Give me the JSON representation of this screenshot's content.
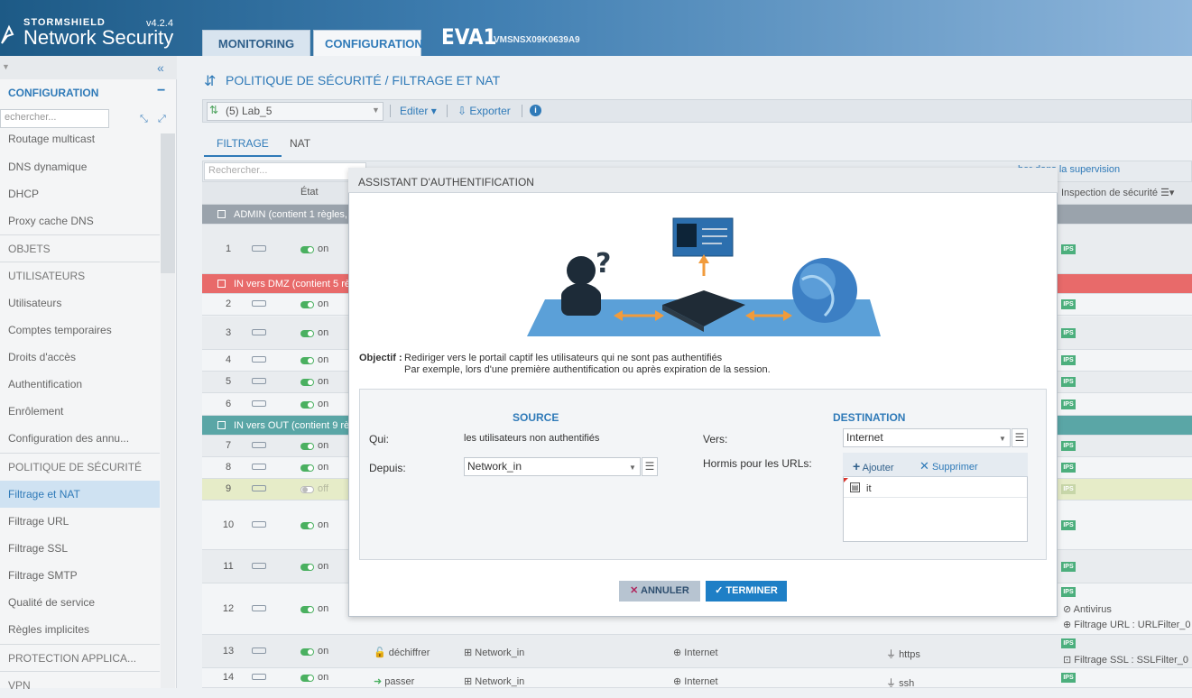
{
  "header": {
    "brand_top": "STORMSHIELD",
    "brand_main": "Network Security",
    "version": "v4.2.4",
    "tabs": [
      "MONITORING",
      "CONFIGURATION"
    ],
    "firewall_name": "EVA1",
    "firewall_serial": "VMSNSX09K0639A9"
  },
  "sidebar": {
    "section_title": "CONFIGURATION",
    "search_placeholder": "echercher...",
    "items": [
      {
        "label": "Routage multicast",
        "type": "item"
      },
      {
        "label": "DNS dynamique",
        "type": "item"
      },
      {
        "label": "DHCP",
        "type": "item"
      },
      {
        "label": "Proxy cache DNS",
        "type": "item"
      },
      {
        "label": "OBJETS",
        "type": "section"
      },
      {
        "label": "UTILISATEURS",
        "type": "section"
      },
      {
        "label": "Utilisateurs",
        "type": "item"
      },
      {
        "label": "Comptes temporaires",
        "type": "item"
      },
      {
        "label": "Droits d'accès",
        "type": "item"
      },
      {
        "label": "Authentification",
        "type": "item"
      },
      {
        "label": "Enrôlement",
        "type": "item"
      },
      {
        "label": "Configuration des annu...",
        "type": "item"
      },
      {
        "label": "POLITIQUE DE SÉCURITÉ",
        "type": "section"
      },
      {
        "label": "Filtrage et NAT",
        "type": "active"
      },
      {
        "label": "Filtrage URL",
        "type": "item"
      },
      {
        "label": "Filtrage SSL",
        "type": "item"
      },
      {
        "label": "Filtrage SMTP",
        "type": "item"
      },
      {
        "label": "Qualité de service",
        "type": "item"
      },
      {
        "label": "Règles implicites",
        "type": "item"
      },
      {
        "label": "PROTECTION APPLICA...",
        "type": "section"
      },
      {
        "label": "VPN",
        "type": "section"
      }
    ]
  },
  "main": {
    "title": "POLITIQUE DE SÉCURITÉ / FILTRAGE ET NAT",
    "policy": "(5) Lab_5",
    "editer": "Editer",
    "exporter": "Exporter",
    "subtabs": [
      "FILTRAGE",
      "NAT"
    ],
    "grid_search_placeholder": "Rechercher...",
    "supervision": "her dans la supervision",
    "col_etat": "État",
    "col_inspection": "Inspection de sécurité",
    "separators": {
      "admin": "ADMIN (contient 1 règles,",
      "dmz": "IN vers DMZ  (contient 5 rè",
      "out": "IN vers OUT (contient 9 rè"
    },
    "rows": [
      {
        "num": "1",
        "state": "on"
      },
      {
        "num": "2",
        "state": "on"
      },
      {
        "num": "3",
        "state": "on"
      },
      {
        "num": "4",
        "state": "on"
      },
      {
        "num": "5",
        "state": "on"
      },
      {
        "num": "6",
        "state": "on"
      },
      {
        "num": "7",
        "state": "on"
      },
      {
        "num": "8",
        "state": "on"
      },
      {
        "num": "9",
        "state": "off"
      },
      {
        "num": "10",
        "state": "on"
      },
      {
        "num": "11",
        "state": "on"
      },
      {
        "num": "12",
        "state": "on"
      },
      {
        "num": "13",
        "state": "on"
      },
      {
        "num": "14",
        "state": "on"
      }
    ],
    "ips_label": "IPS",
    "row12_antivirus": "Antivirus",
    "row12_url": "Filtrage URL : URLFilter_0",
    "row13_action": "déchiffrer",
    "row13_source": "Network_in",
    "row13_dest": "Internet",
    "row13_port": "https",
    "row13_ssl": "Filtrage SSL : SSLFilter_0",
    "row14_action": "passer",
    "row14_source": "Network_in",
    "row14_dest": "Internet",
    "row14_port": "ssh"
  },
  "modal": {
    "title": "ASSISTANT D'AUTHENTIFICATION",
    "objectif_label": "Objectif :",
    "objectif_line1": "Rediriger vers le portail captif les utilisateurs qui ne sont pas authentifiés",
    "objectif_line2": "Par exemple, lors d'une première authentification ou après expiration de la session.",
    "source_heading": "SOURCE",
    "destination_heading": "DESTINATION",
    "qui_label": "Qui:",
    "qui_value": "les utilisateurs non authentifiés",
    "depuis_label": "Depuis:",
    "depuis_value": "Network_in",
    "vers_label": "Vers:",
    "vers_value": "Internet",
    "hormis_label": "Hormis pour les URLs:",
    "ajouter": "Ajouter",
    "supprimer": "Supprimer",
    "url_entries": [
      "it"
    ],
    "annuler": "ANNULER",
    "terminer": "TERMINER"
  },
  "colors": {
    "accent": "#2f7ab8",
    "separator_admin": "#9aa3ac",
    "separator_dmz": "#e86a6a",
    "separator_out": "#5aa6a6",
    "ips_badge": "#4caf7d",
    "terminer_button": "#1e7fc6"
  }
}
